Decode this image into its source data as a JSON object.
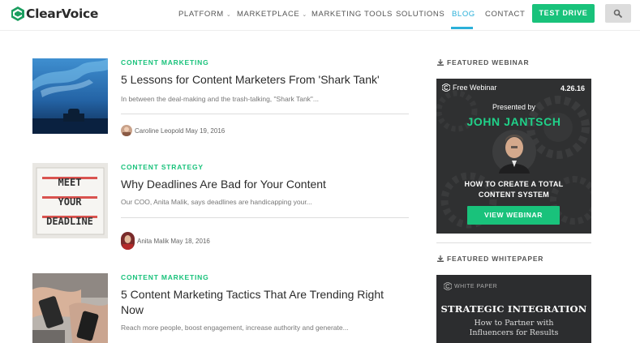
{
  "brand": {
    "name": "ClearVoice",
    "accent": "#19c27b",
    "link_active": "#2bb0d9"
  },
  "nav": {
    "items": [
      {
        "label": "PLATFORM",
        "dropdown": true
      },
      {
        "label": "MARKETPLACE",
        "dropdown": true
      },
      {
        "label": "MARKETING TOOLS",
        "dropdown": false
      },
      {
        "label": "SOLUTIONS",
        "dropdown": false
      },
      {
        "label": "BLOG",
        "dropdown": false,
        "active": true
      },
      {
        "label": "CONTACT",
        "dropdown": false
      }
    ],
    "cta_label": "TEST DRIVE",
    "search_icon": "search-icon"
  },
  "articles": [
    {
      "category": "CONTENT MARKETING",
      "title": "5 Lessons for Content Marketers From 'Shark Tank'",
      "excerpt": "In between the deal-making and the trash-talking, \"Shark Tank\"...",
      "author": "Caroline Leopold",
      "date": "May 19, 2016",
      "thumb": "underwater-shark-photo"
    },
    {
      "category": "CONTENT STRATEGY",
      "title": "Why Deadlines Are Bad for Your Content",
      "excerpt": "Our COO, Anita Malik, says deadlines are handicapping your...",
      "author": "Anita Malik",
      "date": "May 18, 2016",
      "thumb": "meet-your-deadline-lightbox",
      "thumb_text": [
        "MEET",
        "YOUR",
        "DEADLINE"
      ]
    },
    {
      "category": "CONTENT MARKETING",
      "title": "5 Content Marketing Tactics That Are Trending Right Now",
      "excerpt": "Reach more people, boost engagement, increase authority and generate...",
      "thumb": "hands-with-smartphones-photo"
    }
  ],
  "sidebar": {
    "webinar_label": "FEATURED WEBINAR",
    "webinar": {
      "badge": "Free Webinar",
      "date": "4.26.16",
      "presented_by": "Presented by",
      "presenter": "JOHN JANTSCH",
      "topic_line1": "HOW TO CREATE A TOTAL",
      "topic_line2": "CONTENT SYSTEM",
      "button": "VIEW WEBINAR"
    },
    "whitepaper_label": "FEATURED WHITEPAPER",
    "whitepaper": {
      "badge": "WHITE PAPER",
      "title": "STRATEGIC INTEGRATION",
      "subtitle_line1": "How to Partner with",
      "subtitle_line2": "Influencers for Results"
    }
  }
}
